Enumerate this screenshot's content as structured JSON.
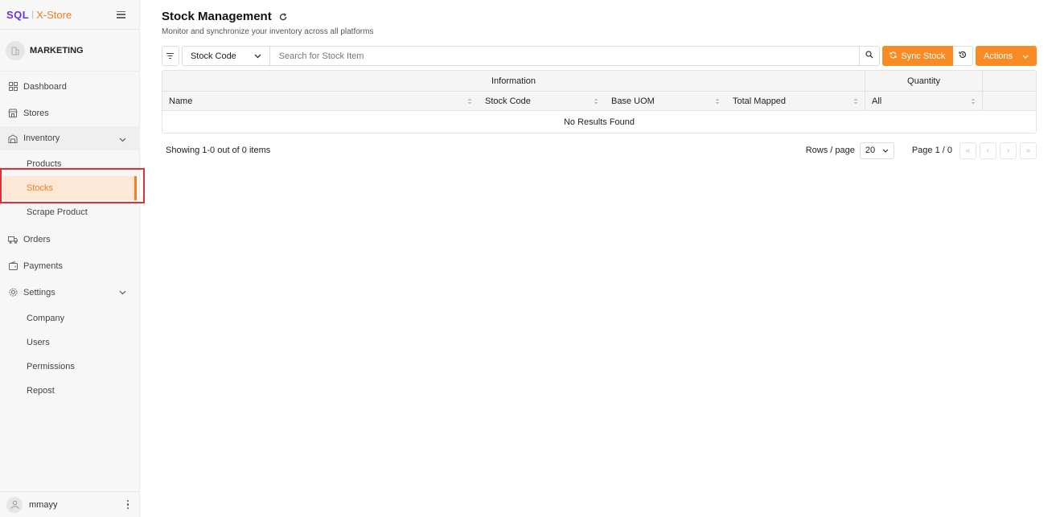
{
  "brand": {
    "sql": "SQL",
    "separator": "|",
    "xstore": "X-Store"
  },
  "org": {
    "name": "MARKETING"
  },
  "sidebar": {
    "dashboard": "Dashboard",
    "stores": "Stores",
    "inventory": "Inventory",
    "inventory_items": [
      "Products",
      "Stocks",
      "Scrape Product"
    ],
    "orders": "Orders",
    "payments": "Payments",
    "settings": "Settings",
    "settings_items": [
      "Company",
      "Users",
      "Permissions",
      "Repost"
    ],
    "active_item": "Stocks"
  },
  "user": {
    "name": "mmayy"
  },
  "page": {
    "title": "Stock Management",
    "subtitle": "Monitor and synchronize your inventory across all platforms"
  },
  "toolbar": {
    "field_select": "Stock Code",
    "search_placeholder": "Search for Stock Item",
    "sync_label": "Sync Stock",
    "actions_label": "Actions"
  },
  "table": {
    "groups": {
      "information": "Information",
      "quantity": "Quantity"
    },
    "columns": [
      "Name",
      "Stock Code",
      "Base UOM",
      "Total Mapped",
      "All"
    ],
    "empty_text": "No Results Found"
  },
  "footer": {
    "showing": "Showing 1-0 out of 0 items",
    "rows_label": "Rows / page",
    "rows_value": "20",
    "page_label": "Page 1 / 0"
  },
  "colors": {
    "accent": "#f98b25",
    "brand_purple": "#6a35d8",
    "active_bg": "#fde8d7",
    "highlight": "#e03131"
  }
}
